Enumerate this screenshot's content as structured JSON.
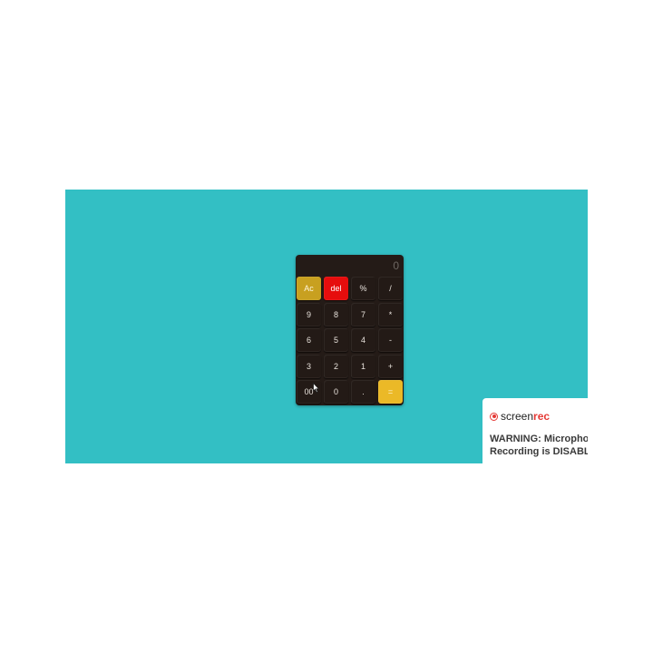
{
  "calculator": {
    "display": "0",
    "keys": [
      {
        "label": "Ac",
        "name": "clear-button",
        "kind": "ac"
      },
      {
        "label": "del",
        "name": "delete-button",
        "kind": "del"
      },
      {
        "label": "%",
        "name": "percent-button",
        "kind": "op"
      },
      {
        "label": "/",
        "name": "divide-button",
        "kind": "op"
      },
      {
        "label": "9",
        "name": "digit-9-button",
        "kind": "num"
      },
      {
        "label": "8",
        "name": "digit-8-button",
        "kind": "num"
      },
      {
        "label": "7",
        "name": "digit-7-button",
        "kind": "num"
      },
      {
        "label": "*",
        "name": "multiply-button",
        "kind": "op"
      },
      {
        "label": "6",
        "name": "digit-6-button",
        "kind": "num"
      },
      {
        "label": "5",
        "name": "digit-5-button",
        "kind": "num"
      },
      {
        "label": "4",
        "name": "digit-4-button",
        "kind": "num"
      },
      {
        "label": "-",
        "name": "subtract-button",
        "kind": "op"
      },
      {
        "label": "3",
        "name": "digit-3-button",
        "kind": "num"
      },
      {
        "label": "2",
        "name": "digit-2-button",
        "kind": "num"
      },
      {
        "label": "1",
        "name": "digit-1-button",
        "kind": "num"
      },
      {
        "label": "+",
        "name": "add-button",
        "kind": "op"
      },
      {
        "label": "00",
        "name": "double-zero-button",
        "kind": "num"
      },
      {
        "label": "0",
        "name": "digit-0-button",
        "kind": "num"
      },
      {
        "label": ".",
        "name": "decimal-button",
        "kind": "num"
      },
      {
        "label": "=",
        "name": "equals-button",
        "kind": "eq"
      }
    ]
  },
  "toast": {
    "brand_part1": "screen",
    "brand_part2": "rec",
    "warning_line1": "WARNING: Microphone",
    "warning_line2": "Recording is DISABLED"
  },
  "colors": {
    "background": "#33bfc4",
    "calculator_body": "#241b17",
    "ac_key": "#c8a020",
    "del_key": "#e60d0d",
    "equals_key": "#ebb927",
    "brand_red": "#e53935"
  }
}
